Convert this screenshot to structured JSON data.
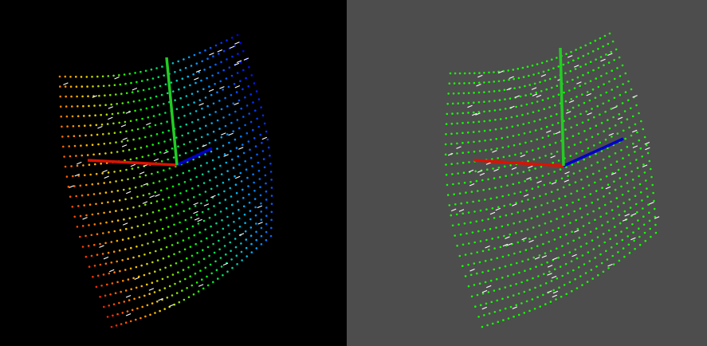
{
  "viewports": [
    {
      "id": "left",
      "background": "#000000",
      "coloring": "gradient",
      "gradient_colors": [
        "#ff1a00",
        "#ffcc00",
        "#00ff00",
        "#00b4ff",
        "#0000ff"
      ],
      "axis_colors": {
        "x": "#dd1100",
        "y": "#22cc22",
        "z": "#0000cc"
      }
    },
    {
      "id": "right",
      "background": "#4d4d4d",
      "coloring": "solid",
      "point_color": "#11ff00",
      "axis_colors": {
        "x": "#dd1100",
        "y": "#22cc22",
        "z": "#0000cc"
      }
    }
  ],
  "normal_marker_color": "#ffffff"
}
